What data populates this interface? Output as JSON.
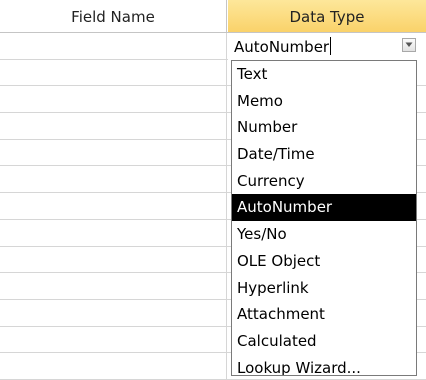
{
  "header": {
    "field_name": "Field Name",
    "data_type": "Data Type"
  },
  "combo": {
    "value": "AutoNumber",
    "arrow_icon": "dropdown-arrow-icon"
  },
  "dropdown": {
    "selected": "AutoNumber",
    "options": [
      "Text",
      "Memo",
      "Number",
      "Date/Time",
      "Currency",
      "AutoNumber",
      "Yes/No",
      "OLE Object",
      "Hyperlink",
      "Attachment",
      "Calculated",
      "Lookup Wizard..."
    ]
  },
  "colors": {
    "header_highlight": "#fad26a",
    "selection_bg": "#000000",
    "selection_text": "#ffffff",
    "gridline": "#d6d6d6"
  }
}
